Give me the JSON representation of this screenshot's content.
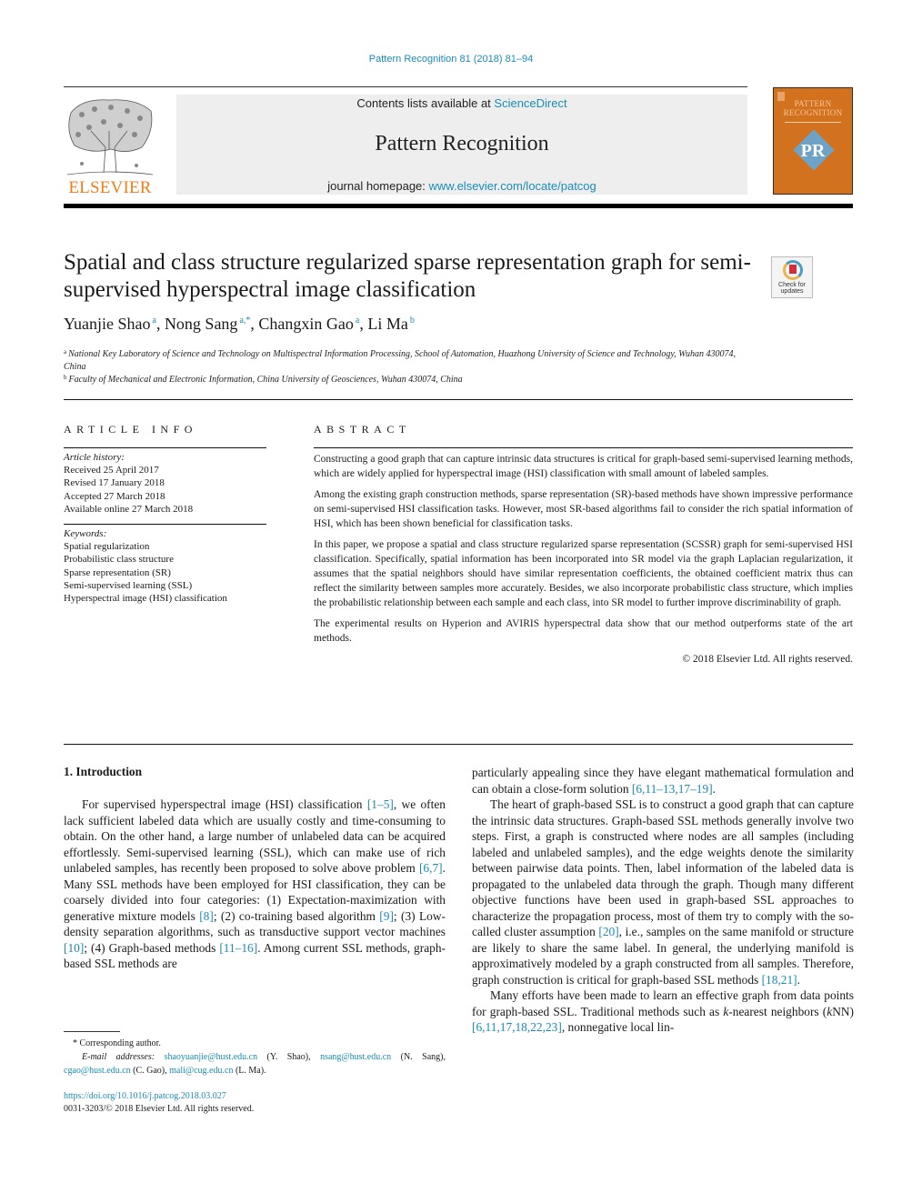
{
  "citation": "Pattern Recognition 81 (2018) 81–94",
  "header": {
    "publisher_logo_text": "ELSEVIER",
    "contents_prefix": "Contents lists available at ",
    "contents_link": "ScienceDirect",
    "journal_name": "Pattern Recognition",
    "homepage_prefix": "journal homepage: ",
    "homepage_link": "www.elsevier.com/locate/patcog",
    "cover_title_line1": "PATTERN",
    "cover_title_line2": "RECOGNITION",
    "cover_logo": "PR"
  },
  "crossmark": {
    "line1": "Check for",
    "line2": "updates"
  },
  "title": "Spatial and class structure regularized sparse representation graph for semi-supervised hyperspectral image classification",
  "authors": [
    {
      "name": "Yuanjie Shao",
      "sup": "a",
      "sep": ", "
    },
    {
      "name": "Nong Sang",
      "sup": "a,*",
      "sep": ", "
    },
    {
      "name": "Changxin Gao",
      "sup": "a",
      "sep": ", "
    },
    {
      "name": "Li Ma",
      "sup": "b",
      "sep": ""
    }
  ],
  "affiliations": [
    {
      "key": "a",
      "text": "National Key Laboratory of Science and Technology on Multispectral Information Processing, School of Automation, Huazhong University of Science and Technology, Wuhan 430074, China"
    },
    {
      "key": "b",
      "text": "Faculty of Mechanical and Electronic Information, China University of Geosciences, Wuhan 430074, China"
    }
  ],
  "article_info": {
    "heading": "ARTICLE INFO",
    "history_label": "Article history:",
    "history": [
      "Received 25 April 2017",
      "Revised 17 January 2018",
      "Accepted 27 March 2018",
      "Available online 27 March 2018"
    ],
    "keywords_label": "Keywords:",
    "keywords": [
      "Spatial regularization",
      "Probabilistic class structure",
      "Sparse representation (SR)",
      "Semi-supervised learning (SSL)",
      "Hyperspectral image (HSI) classification"
    ]
  },
  "abstract": {
    "heading": "ABSTRACT",
    "paragraphs": [
      "Constructing a good graph that can capture intrinsic data structures is critical for graph-based semi-supervised learning methods, which are widely applied for hyperspectral image (HSI) classification with small amount of labeled samples.",
      "Among the existing graph construction methods, sparse representation (SR)-based methods have shown impressive performance on semi-supervised HSI classification tasks. However, most SR-based algorithms fail to consider the rich spatial information of HSI, which has been shown beneficial for classification tasks.",
      "In this paper, we propose a spatial and class structure regularized sparse representation (SCSSR) graph for semi-supervised HSI classification. Specifically, spatial information has been incorporated into SR model via the graph Laplacian regularization, it assumes that the spatial neighbors should have similar representation coefficients, the obtained coefficient matrix thus can reflect the similarity between samples more accurately. Besides, we also incorporate probabilistic class structure, which implies the probabilistic relationship between each sample and each class, into SR model to further improve discriminability of graph.",
      "The experimental results on Hyperion and AVIRIS hyperspectral data show that our method outperforms state of the art methods."
    ],
    "copyright": "© 2018 Elsevier Ltd. All rights reserved."
  },
  "section": {
    "heading": "1. Introduction",
    "left_paragraph": [
      {
        "t": "For supervised hyperspectral image (HSI) classification "
      },
      {
        "ref": "[1–5]"
      },
      {
        "t": ", we often lack sufficient labeled data which are usually costly and time-consuming to obtain. On the other hand, a large number of unlabeled data can be acquired effortlessly. Semi-supervised learn­ing (SSL), which can make use of rich unlabeled samples, has recently been proposed to solve above problem "
      },
      {
        "ref": "[6,7]"
      },
      {
        "t": ". Many SSL methods have been employed for HSI classification, they can be coarsely divided into four categories: (1) Expectation-maximization with generative mixture models "
      },
      {
        "ref": "[8]"
      },
      {
        "t": "; (2) co-training based algo­rithm "
      },
      {
        "ref": "[9]"
      },
      {
        "t": "; (3) Low-density separation algorithms, such as trans­ductive support vector machines "
      },
      {
        "ref": "[10]"
      },
      {
        "t": "; (4) Graph-based methods "
      },
      {
        "ref": "[11–16]"
      },
      {
        "t": ". Among current SSL methods, graph-based SSL methods are"
      }
    ],
    "right_paragraphs": [
      [
        {
          "t": "particularly appealing since they have elegant mathematical for­mulation and can obtain a close-form solution "
        },
        {
          "ref": "[6,11–13,17–19]"
        },
        {
          "t": "."
        }
      ],
      [
        {
          "t": "The heart of graph-based SSL is to construct a good graph that can capture the intrinsic data structures. Graph-based SSL meth­ods generally involve two steps. First, a graph is constructed where nodes are all samples (including labeled and unlabeled samples), and the edge weights denote the similarity between pairwise data points. Then, label information of the labeled data is propagated to the unlabeled data through the graph. Though many different objective functions have been used in graph-based SSL approaches to characterize the propagation process, most of them try to com­ply with the so-called cluster assumption "
        },
        {
          "ref": "[20]"
        },
        {
          "t": ", i.e., samples on the same manifold or structure are likely to share the same label. In general, the underlying manifold is approximatively modeled by a graph constructed from all samples. Therefore, graph construction is critical for graph-based SSL methods "
        },
        {
          "ref": "[18,21]"
        },
        {
          "t": "."
        }
      ],
      [
        {
          "t": "Many efforts have been made to learn an effective graph from data points for graph-based SSL. Traditional methods such as "
        },
        {
          "i": "k"
        },
        {
          "t": "-nearest neighbors ("
        },
        {
          "i": "k"
        },
        {
          "t": "NN) "
        },
        {
          "ref": "[6,11,17,18,22,23]"
        },
        {
          "t": ", nonnegative local lin-"
        }
      ]
    ]
  },
  "footnotes": {
    "corresponding_mark": "*",
    "corresponding": "Corresponding author.",
    "email_label": "E-mail addresses:",
    "emails": [
      {
        "addr": "shaoyuanjie@hust.edu.cn",
        "who": " (Y. Shao), "
      },
      {
        "addr": "nsang@hust.edu.cn",
        "who": " (N. Sang), "
      },
      {
        "addr": "cgao@hust.edu.cn",
        "who": " (C. Gao), "
      },
      {
        "addr": "mali@cug.edu.cn",
        "who": " (L. Ma)."
      }
    ],
    "doi": "https://doi.org/10.1016/j.patcog.2018.03.027",
    "issn_copyright": "0031-3203/© 2018 Elsevier Ltd. All rights reserved."
  }
}
